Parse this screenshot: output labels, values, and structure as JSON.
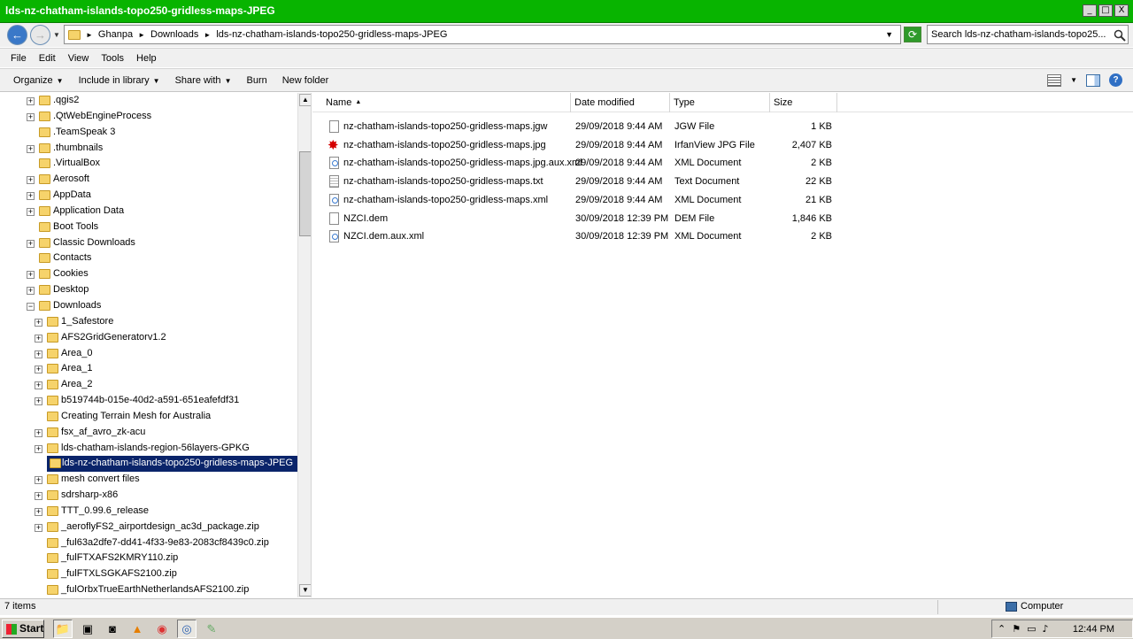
{
  "window": {
    "title": "lds-nz-chatham-islands-topo250-gridless-maps-JPEG",
    "min": "_",
    "max": "□",
    "close": "X"
  },
  "address": {
    "crumbs": [
      "Ghanpa",
      "Downloads",
      "lds-nz-chatham-islands-topo250-gridless-maps-JPEG"
    ],
    "sep": "►"
  },
  "search": {
    "placeholder": "Search lds-nz-chatham-islands-topo25..."
  },
  "menu": [
    "File",
    "Edit",
    "View",
    "Tools",
    "Help"
  ],
  "commands": [
    {
      "label": "Organize",
      "drop": true
    },
    {
      "label": "Include in library",
      "drop": true
    },
    {
      "label": "Share with",
      "drop": true
    },
    {
      "label": "Burn",
      "drop": false
    },
    {
      "label": "New folder",
      "drop": false
    }
  ],
  "tree": [
    {
      "label": ".qgis2",
      "level": 0,
      "exp": "+"
    },
    {
      "label": ".QtWebEngineProcess",
      "level": 0,
      "exp": "+"
    },
    {
      "label": ".TeamSpeak 3",
      "level": 0,
      "exp": ""
    },
    {
      "label": ".thumbnails",
      "level": 0,
      "exp": "+"
    },
    {
      "label": ".VirtualBox",
      "level": 0,
      "exp": ""
    },
    {
      "label": "Aerosoft",
      "level": 0,
      "exp": "+"
    },
    {
      "label": "AppData",
      "level": 0,
      "exp": "+"
    },
    {
      "label": "Application Data",
      "level": 0,
      "exp": "+"
    },
    {
      "label": "Boot Tools",
      "level": 0,
      "exp": ""
    },
    {
      "label": "Classic Downloads",
      "level": 0,
      "exp": "+"
    },
    {
      "label": "Contacts",
      "level": 0,
      "exp": ""
    },
    {
      "label": "Cookies",
      "level": 0,
      "exp": "+"
    },
    {
      "label": "Desktop",
      "level": 0,
      "exp": "+"
    },
    {
      "label": "Downloads",
      "level": 0,
      "exp": "−"
    },
    {
      "label": "1_Safestore",
      "level": 1,
      "exp": "+"
    },
    {
      "label": "AFS2GridGeneratorv1.2",
      "level": 1,
      "exp": "+"
    },
    {
      "label": "Area_0",
      "level": 1,
      "exp": "+"
    },
    {
      "label": "Area_1",
      "level": 1,
      "exp": "+"
    },
    {
      "label": "Area_2",
      "level": 1,
      "exp": "+"
    },
    {
      "label": "b519744b-015e-40d2-a591-651eafefdf31",
      "level": 1,
      "exp": "+"
    },
    {
      "label": "Creating Terrain Mesh for Australia",
      "level": 1,
      "exp": ""
    },
    {
      "label": "fsx_af_avro_zk-acu",
      "level": 1,
      "exp": "+"
    },
    {
      "label": "lds-chatham-islands-region-56layers-GPKG",
      "level": 1,
      "exp": "+"
    },
    {
      "label": "lds-nz-chatham-islands-topo250-gridless-maps-JPEG",
      "level": 1,
      "exp": "",
      "selected": true
    },
    {
      "label": "mesh convert files",
      "level": 1,
      "exp": "+"
    },
    {
      "label": "sdrsharp-x86",
      "level": 1,
      "exp": "+"
    },
    {
      "label": "TTT_0.99.6_release",
      "level": 1,
      "exp": "+"
    },
    {
      "label": "_aeroflyFS2_airportdesign_ac3d_package.zip",
      "level": 1,
      "exp": "+"
    },
    {
      "label": "_ful63a2dfe7-dd41-4f33-9e83-2083cf8439c0.zip",
      "level": 1,
      "exp": ""
    },
    {
      "label": "_fulFTXAFS2KMRY110.zip",
      "level": 1,
      "exp": ""
    },
    {
      "label": "_fulFTXLSGKAFS2100.zip",
      "level": 1,
      "exp": ""
    },
    {
      "label": "_fulOrbxTrueEarthNetherlandsAFS2100.zip",
      "level": 1,
      "exp": ""
    }
  ],
  "columns": {
    "name": "Name",
    "date": "Date modified",
    "type": "Type",
    "size": "Size",
    "sort": "▲"
  },
  "files": [
    {
      "name": "nz-chatham-islands-topo250-gridless-maps.jgw",
      "date": "29/09/2018 9:44 AM",
      "type": "JGW File",
      "size": "1 KB",
      "icon": "file"
    },
    {
      "name": "nz-chatham-islands-topo250-gridless-maps.jpg",
      "date": "29/09/2018 9:44 AM",
      "type": "IrfanView JPG File",
      "size": "2,407 KB",
      "icon": "jpg"
    },
    {
      "name": "nz-chatham-islands-topo250-gridless-maps.jpg.aux.xml",
      "date": "29/09/2018 9:44 AM",
      "type": "XML Document",
      "size": "2 KB",
      "icon": "xml"
    },
    {
      "name": "nz-chatham-islands-topo250-gridless-maps.txt",
      "date": "29/09/2018 9:44 AM",
      "type": "Text Document",
      "size": "22 KB",
      "icon": "txt"
    },
    {
      "name": "nz-chatham-islands-topo250-gridless-maps.xml",
      "date": "29/09/2018 9:44 AM",
      "type": "XML Document",
      "size": "21 KB",
      "icon": "xml"
    },
    {
      "name": "NZCI.dem",
      "date": "30/09/2018 12:39 PM",
      "type": "DEM File",
      "size": "1,846 KB",
      "icon": "file"
    },
    {
      "name": "NZCI.dem.aux.xml",
      "date": "30/09/2018 12:39 PM",
      "type": "XML Document",
      "size": "2 KB",
      "icon": "xml"
    }
  ],
  "status": {
    "count": "7 items",
    "location": "Computer"
  },
  "taskbar": {
    "start": "Start",
    "clock": "12:44 PM"
  },
  "colors": {
    "titlebar": "#08b400",
    "selection": "#0a246a"
  }
}
